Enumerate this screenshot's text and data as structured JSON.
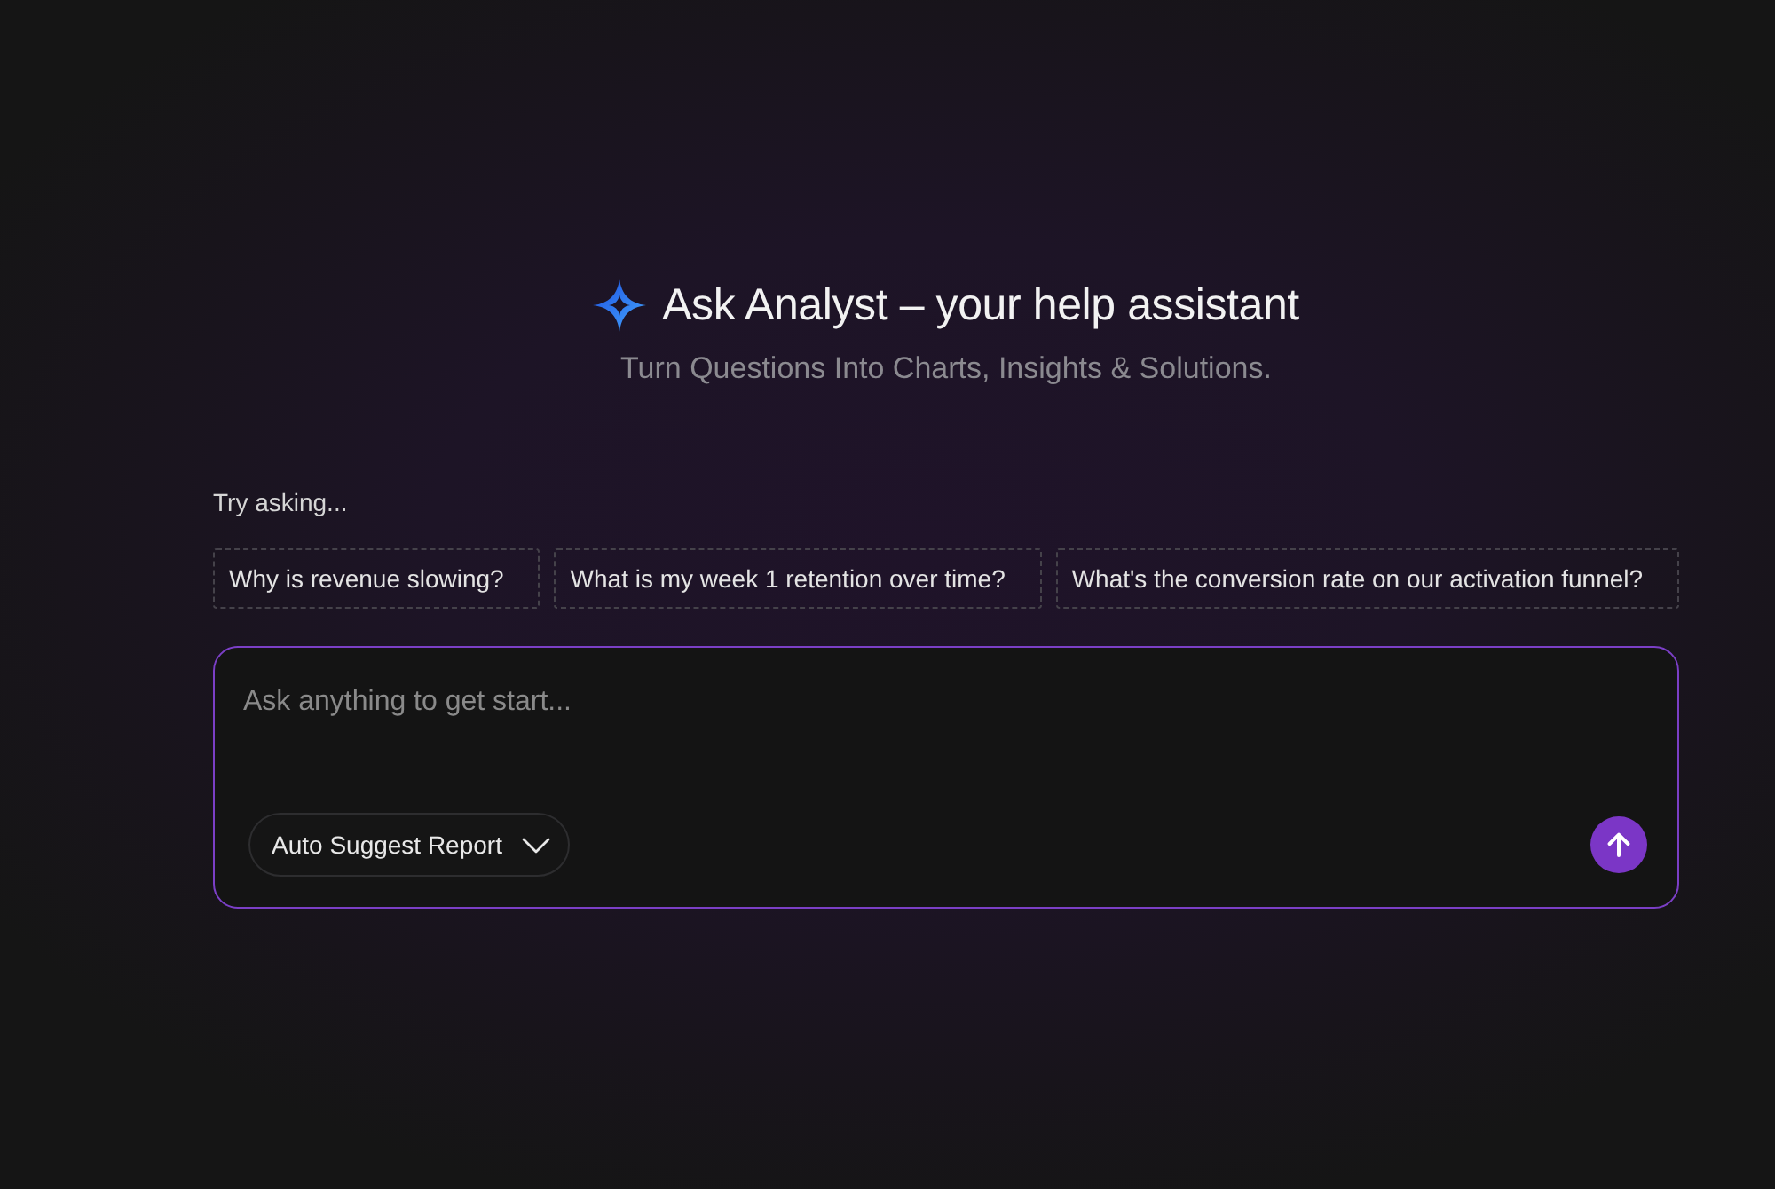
{
  "header": {
    "title": "Ask Analyst – your help assistant",
    "subtitle": "Turn Questions Into Charts, Insights & Solutions."
  },
  "suggestions": {
    "label": "Try asking...",
    "items": [
      "Why is revenue slowing?",
      "What is my week 1 retention over time?",
      "What's the conversion rate on our activation funnel?"
    ]
  },
  "composer": {
    "placeholder": "Ask anything to get start...",
    "report_selector": {
      "label": "Auto Suggest Report"
    }
  }
}
